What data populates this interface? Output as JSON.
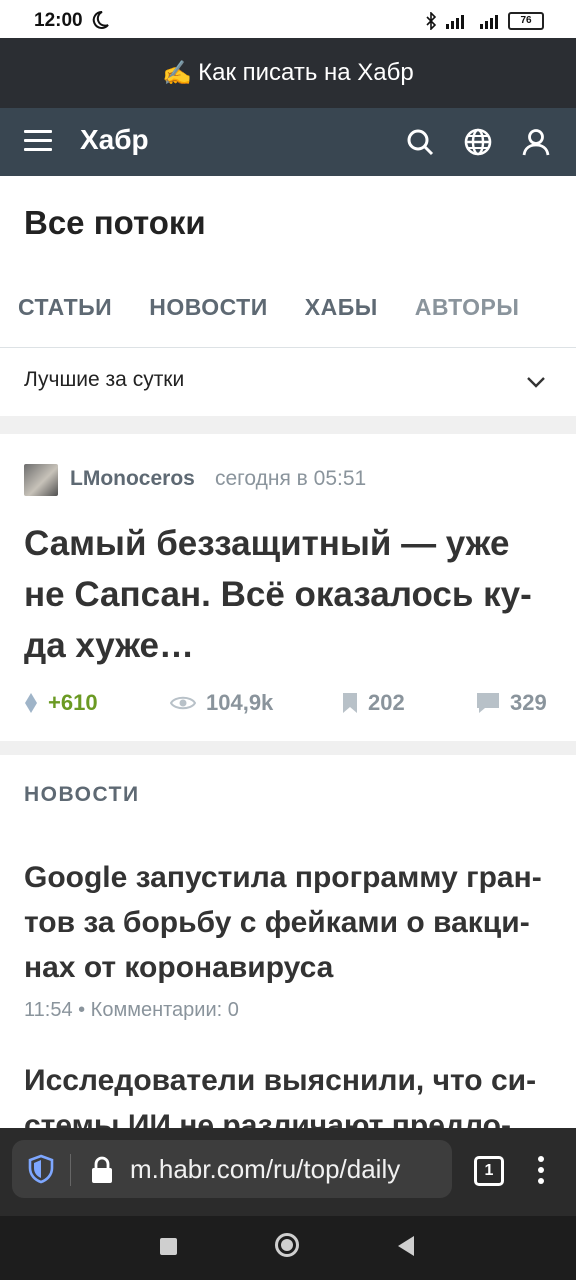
{
  "status_bar": {
    "time": "12:00",
    "battery": "76"
  },
  "promo": {
    "icon": "writing-hand-icon",
    "text": "Как писать на Хабр"
  },
  "header": {
    "logo": "Хабр",
    "icons": [
      "menu-icon",
      "search-icon",
      "globe-icon",
      "user-icon"
    ]
  },
  "page": {
    "title": "Все потоки"
  },
  "tabs": [
    {
      "label": "СТАТЬИ"
    },
    {
      "label": "НОВОСТИ"
    },
    {
      "label": "ХАБЫ"
    },
    {
      "label": "АВТОРЫ"
    }
  ],
  "filter": {
    "selected": "Лучшие за сутки"
  },
  "article": {
    "author": "LMonoceros",
    "date": "сегодня в 05:51",
    "title": "Самый беззащитный — уже не Сапсан. Всё оказалось ку­да хуже…",
    "rating": "+610",
    "views": "104,9k",
    "bookmarks": "202",
    "comments": "329"
  },
  "news": {
    "heading": "НОВОСТИ",
    "items": [
      {
        "title": "Google запустила программу гран­тов за борьбу с фейками о вакци­нах от коронавируса",
        "meta": "11:54 • Комментарии: 0"
      },
      {
        "title": "Исследователи выяснили, что си­стемы ИИ не различают предло-"
      }
    ]
  },
  "browser": {
    "url": "m.habr.com/ru/top/daily",
    "tab_count": "1"
  },
  "colors": {
    "header_bg": "#394651",
    "promo_bg": "#2b2e33",
    "rating_green": "#6b9a23",
    "text_muted": "#8a949c"
  }
}
